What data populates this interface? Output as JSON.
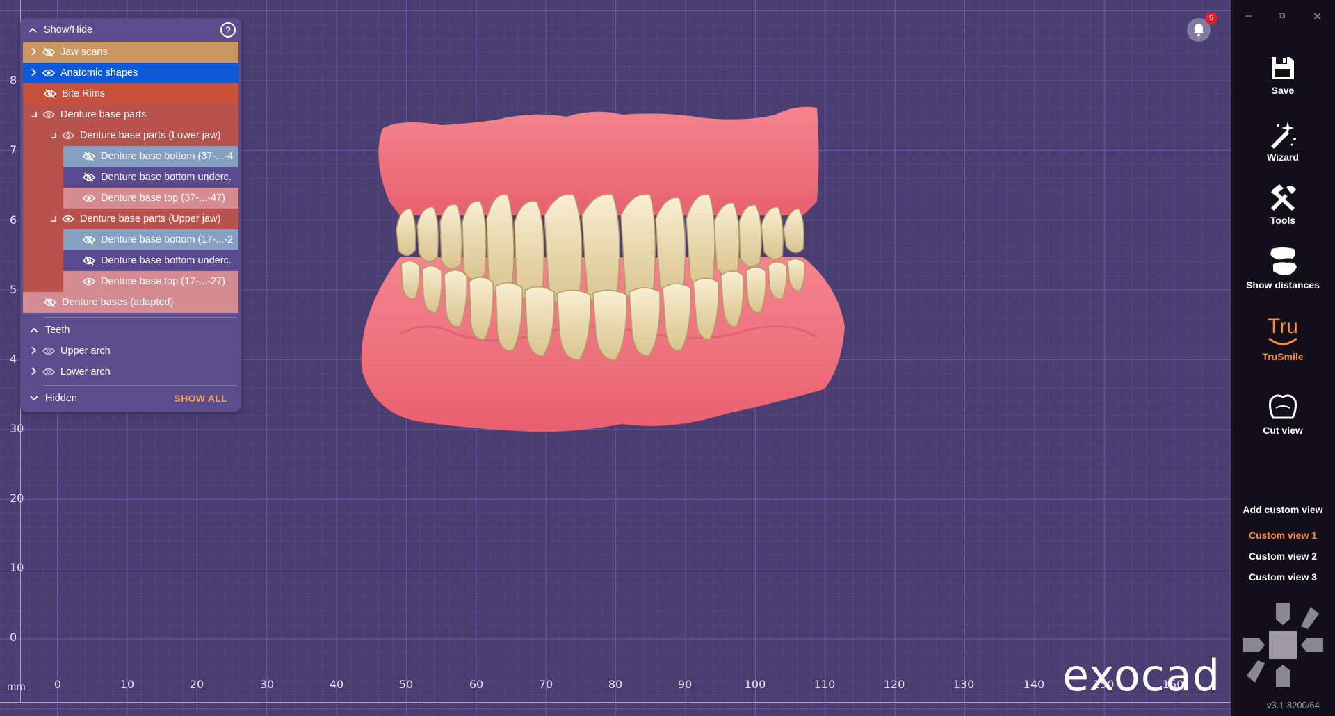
{
  "panel": {
    "title": "Show/Hide",
    "rows": [
      {
        "label": "Jaw scans",
        "visible": false,
        "bg": "#c9975f"
      },
      {
        "label": "Anatomic shapes",
        "visible": true,
        "bg": "#0e5ad6"
      },
      {
        "label": "Bite Rims",
        "visible": false,
        "bg": "#c8503a"
      },
      {
        "label": "Denture base parts",
        "visible": true,
        "bg": "#b7534c"
      },
      {
        "label": "Denture base parts (Lower jaw)",
        "visible": true,
        "bg": "#b7534c"
      },
      {
        "label": "Denture base bottom (37-...-4",
        "visible": false,
        "bg": "#86a0c4"
      },
      {
        "label": "Denture base bottom underc.",
        "visible": false,
        "bg": "#5a4a92"
      },
      {
        "label": "Denture base top (37-...-47)",
        "visible": true,
        "bg": "#d48b92"
      },
      {
        "label": "Denture base parts (Upper jaw)",
        "visible": true,
        "bg": "#b7534c"
      },
      {
        "label": "Denture base bottom (17-...-2",
        "visible": false,
        "bg": "#86a0c4"
      },
      {
        "label": "Denture base bottom underc.",
        "visible": false,
        "bg": "#5a4a92"
      },
      {
        "label": "Denture base top (17-...-27)",
        "visible": true,
        "bg": "#d48b92"
      },
      {
        "label": "Denture bases (adapted)",
        "visible": false,
        "bg": "#d48b92"
      }
    ],
    "teeth_section": "Teeth",
    "teeth_rows": [
      {
        "label": "Upper arch"
      },
      {
        "label": "Lower arch"
      }
    ],
    "hidden_section": "Hidden",
    "show_all": "SHOW ALL"
  },
  "notifications": {
    "count": "5"
  },
  "ruler": {
    "unit": "mm",
    "y_ticks": [
      "8",
      "7",
      "6",
      "5",
      "4",
      "30",
      "20",
      "10",
      "0"
    ],
    "x_ticks": [
      "0",
      "10",
      "20",
      "30",
      "40",
      "50",
      "60",
      "70",
      "80",
      "90",
      "100",
      "110",
      "120",
      "130",
      "140",
      "150",
      "160"
    ]
  },
  "brand": "exocad",
  "sidebar": {
    "tools": [
      {
        "label": "Save",
        "icon": "save-icon"
      },
      {
        "label": "Wizard",
        "icon": "wizard-icon"
      },
      {
        "label": "Tools",
        "icon": "tools-icon"
      },
      {
        "label": "Show distances",
        "icon": "show-distances-icon"
      },
      {
        "label": "TruSmile",
        "icon": "trusmile-icon",
        "logo_text": "Tru"
      },
      {
        "label": "Cut view",
        "icon": "cut-view-icon"
      }
    ],
    "custom_views_title": "Add custom view",
    "custom_views": [
      "Custom view 1",
      "Custom view 2",
      "Custom view 3"
    ],
    "active_custom_view": "Custom view 1",
    "version": "v3.1-8200/64"
  },
  "colors": {
    "accent_orange": "#f28c3a",
    "viewport_bg": "#4a3d70",
    "gum": "#ee6f7d",
    "tooth": "#f1e4bd"
  }
}
